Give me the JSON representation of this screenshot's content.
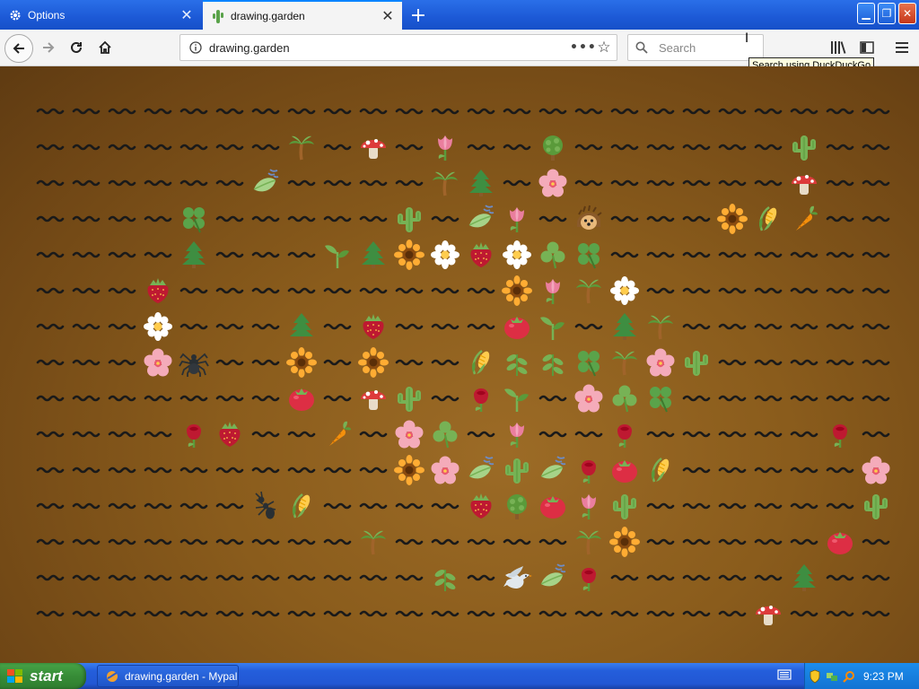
{
  "browser": {
    "tabs": [
      {
        "title": "Options",
        "icon": "gear-icon"
      },
      {
        "title": "drawing.garden",
        "icon": "cactus-icon"
      }
    ],
    "url": "drawing.garden",
    "search_placeholder": "Search",
    "tooltip": "Search using DuckDuckGo"
  },
  "taskbar": {
    "start_label": "start",
    "task_title": "drawing.garden - Mypal",
    "clock": "9:23 PM"
  },
  "garden": {
    "rows": 15,
    "cols": 24,
    "cells": [
      [
        1,
        7,
        "palm"
      ],
      [
        1,
        9,
        "mushroom"
      ],
      [
        1,
        11,
        "tulip"
      ],
      [
        1,
        14,
        "bush"
      ],
      [
        1,
        21,
        "cactus"
      ],
      [
        2,
        6,
        "leafwind"
      ],
      [
        2,
        11,
        "palm"
      ],
      [
        2,
        12,
        "pine"
      ],
      [
        2,
        14,
        "blossom"
      ],
      [
        2,
        21,
        "mushroom"
      ],
      [
        3,
        4,
        "clover"
      ],
      [
        3,
        10,
        "cactus"
      ],
      [
        3,
        12,
        "leafwind"
      ],
      [
        3,
        13,
        "tulip"
      ],
      [
        3,
        15,
        "hedgehog"
      ],
      [
        3,
        19,
        "sunflower"
      ],
      [
        3,
        20,
        "corn"
      ],
      [
        3,
        21,
        "carrot"
      ],
      [
        4,
        4,
        "pine"
      ],
      [
        4,
        8,
        "sprout"
      ],
      [
        4,
        9,
        "pine"
      ],
      [
        4,
        10,
        "sunflower"
      ],
      [
        4,
        11,
        "daisy"
      ],
      [
        4,
        12,
        "strawberry"
      ],
      [
        4,
        13,
        "daisy"
      ],
      [
        4,
        14,
        "shamrock"
      ],
      [
        4,
        15,
        "clover"
      ],
      [
        5,
        3,
        "strawberry"
      ],
      [
        5,
        13,
        "sunflower"
      ],
      [
        5,
        14,
        "tulip"
      ],
      [
        5,
        15,
        "palm"
      ],
      [
        5,
        16,
        "daisy"
      ],
      [
        6,
        3,
        "daisy"
      ],
      [
        6,
        7,
        "pine"
      ],
      [
        6,
        9,
        "strawberry"
      ],
      [
        6,
        13,
        "tomato"
      ],
      [
        6,
        14,
        "sprout"
      ],
      [
        6,
        16,
        "pine"
      ],
      [
        6,
        17,
        "palm"
      ],
      [
        7,
        3,
        "blossom"
      ],
      [
        7,
        4,
        "spider"
      ],
      [
        7,
        7,
        "sunflower"
      ],
      [
        7,
        9,
        "sunflower"
      ],
      [
        7,
        12,
        "corn"
      ],
      [
        7,
        13,
        "herb"
      ],
      [
        7,
        14,
        "herb"
      ],
      [
        7,
        15,
        "clover"
      ],
      [
        7,
        16,
        "palm"
      ],
      [
        7,
        17,
        "blossom"
      ],
      [
        7,
        18,
        "cactus"
      ],
      [
        8,
        7,
        "tomato"
      ],
      [
        8,
        9,
        "mushroom"
      ],
      [
        8,
        10,
        "cactus"
      ],
      [
        8,
        12,
        "rose"
      ],
      [
        8,
        13,
        "sprout"
      ],
      [
        8,
        15,
        "blossom"
      ],
      [
        8,
        16,
        "shamrock"
      ],
      [
        8,
        17,
        "clover"
      ],
      [
        9,
        4,
        "rose"
      ],
      [
        9,
        5,
        "strawberry"
      ],
      [
        9,
        8,
        "carrot"
      ],
      [
        9,
        10,
        "blossom"
      ],
      [
        9,
        11,
        "shamrock"
      ],
      [
        9,
        13,
        "tulip"
      ],
      [
        9,
        16,
        "rose"
      ],
      [
        9,
        22,
        "rose"
      ],
      [
        10,
        10,
        "sunflower"
      ],
      [
        10,
        11,
        "blossom"
      ],
      [
        10,
        12,
        "leafwind"
      ],
      [
        10,
        13,
        "cactus"
      ],
      [
        10,
        14,
        "leafwind"
      ],
      [
        10,
        15,
        "rose"
      ],
      [
        10,
        16,
        "tomato"
      ],
      [
        10,
        17,
        "corn"
      ],
      [
        10,
        23,
        "blossom"
      ],
      [
        11,
        6,
        "ant"
      ],
      [
        11,
        7,
        "corn"
      ],
      [
        11,
        12,
        "strawberry"
      ],
      [
        11,
        13,
        "bush"
      ],
      [
        11,
        14,
        "tomato"
      ],
      [
        11,
        15,
        "tulip"
      ],
      [
        11,
        16,
        "cactus"
      ],
      [
        11,
        23,
        "cactus"
      ],
      [
        12,
        9,
        "palm"
      ],
      [
        12,
        15,
        "palm"
      ],
      [
        12,
        16,
        "sunflower"
      ],
      [
        12,
        22,
        "tomato"
      ],
      [
        13,
        11,
        "herb"
      ],
      [
        13,
        13,
        "dove"
      ],
      [
        13,
        14,
        "leafwind"
      ],
      [
        13,
        15,
        "rose"
      ],
      [
        13,
        21,
        "pine"
      ],
      [
        14,
        20,
        "mushroom"
      ]
    ],
    "colors": {
      "soil_dark": "#5f3b12",
      "soil_light": "#9c6b26",
      "wave": "#1a1a1a"
    }
  }
}
